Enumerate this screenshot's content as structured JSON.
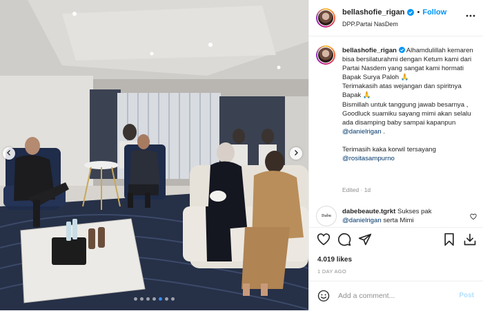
{
  "colors": {
    "accent": "#0095f6",
    "verified": "#0095f6",
    "mention": "#00376b",
    "muted": "#8e8e8e",
    "post_disabled": "#b2dffc"
  },
  "carousel": {
    "total": 7,
    "active_index": 4
  },
  "header": {
    "username": "bellashofie_rigan",
    "separator": "•",
    "follow_label": "Follow",
    "location": "DPP.Partai NasDem",
    "more_icon": "more-horizontal-icon"
  },
  "caption": {
    "username": "bellashofie_rigan",
    "line1": "Alhamdulillah kemaren bisa bersilaturahmi dengan Ketum kami dari Partai Nasdem yang sangat kami hormati Bapak Surya Paloh 🙏",
    "line2": "Terimakasih atas wejangan dan spiritnya Bapak 🙏",
    "line3_before": "Bismillah untuk tanggung jawab besarnya , Goodluck suamiku sayang mimi akan selalu ada disamping baby sampai kapanpun ",
    "line3_mention": "@danielrigan",
    "line3_after": " .",
    "line4": "Terimasih kaka korwil tersayang",
    "line4_mention": "@rositasampurno",
    "edited": "Edited",
    "edited_sep": "·",
    "edited_time": "1d"
  },
  "comment": {
    "avatar_text": "Dabu",
    "username": "dabebeaute.tgrkt",
    "text": "Sukses pak",
    "mention": "@danielrigan",
    "text_after": "serta Mimi"
  },
  "actions": {
    "like_icon": "heart-icon",
    "comment_icon": "comment-icon",
    "share_icon": "send-icon",
    "save_icon": "bookmark-icon",
    "download_icon": "download-icon"
  },
  "likes": "4.019 likes",
  "date": "1 DAY AGO",
  "add_comment": {
    "placeholder": "Add a comment...",
    "post_label": "Post"
  }
}
